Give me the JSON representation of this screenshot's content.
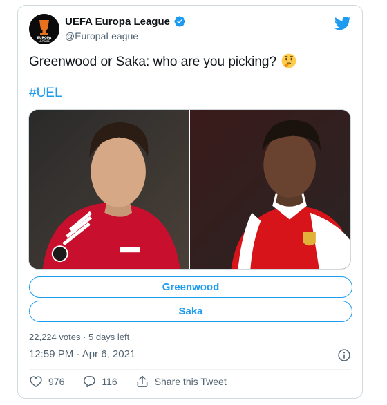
{
  "account": {
    "name": "UEFA Europa League",
    "handle": "@EuropaLeague",
    "logo_text": "EUROPA LEAGUE"
  },
  "tweet": {
    "text": "Greenwood or Saka: who are you picking?",
    "emoji": "thinking-face",
    "hashtag": "#UEL"
  },
  "media": {
    "left_description": "player-photo-left",
    "right_description": "player-photo-right"
  },
  "poll": {
    "options": [
      "Greenwood",
      "Saka"
    ],
    "meta": "22,224 votes · 5 days left"
  },
  "timestamp": "12:59 PM · Apr 6, 2021",
  "actions": {
    "likes": "976",
    "replies": "116",
    "share_label": "Share this Tweet"
  },
  "colors": {
    "accent": "#1d9bf0",
    "text": "#0f1419",
    "muted": "#536471",
    "border": "#cfd9de"
  }
}
